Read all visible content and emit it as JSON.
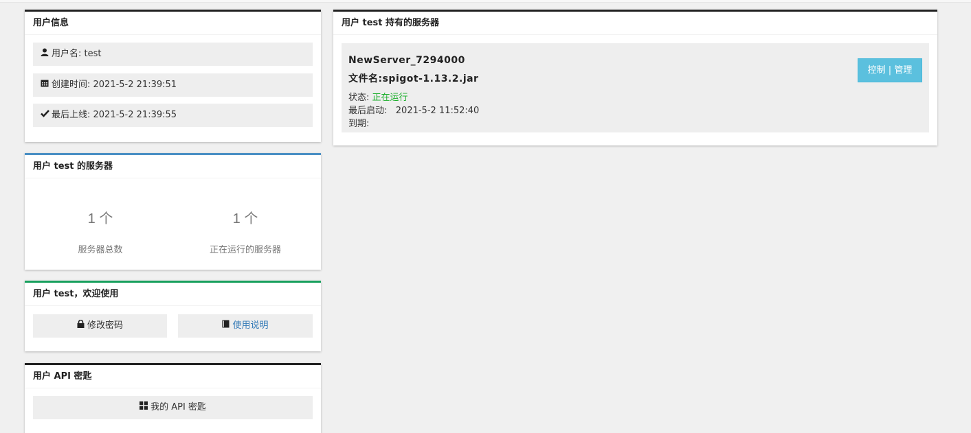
{
  "user_info": {
    "title": "用户信息",
    "username_label": "用户名: test",
    "created_label": "创建时间: 2021-5-2 21:39:51",
    "last_login_label": "最后上线: 2021-5-2 21:39:55"
  },
  "user_servers": {
    "title": "用户 test 的服务器",
    "total_count": "1 个",
    "total_label": "服务器总数",
    "running_count": "1 个",
    "running_label": "正在运行的服务器"
  },
  "welcome": {
    "title": "用户 test，欢迎使用",
    "change_password": "修改密码",
    "manual": "使用说明"
  },
  "api": {
    "title": "用户 API 密匙",
    "my_api_key": "我的 API 密匙"
  },
  "owned_servers": {
    "title": "用户 test 持有的服务器",
    "server": {
      "name": "NewServer_7294000",
      "file": "文件名:spigot-1.13.2.jar",
      "status_label": "状态: ",
      "status_value": "正在运行",
      "last_start": "最后启动:   2021-5-2 11:52:40",
      "expire": "到期:",
      "control_button": "控制 | 管理"
    }
  },
  "colors": {
    "accent_blue": "#4a8fc4",
    "accent_green": "#18a05e",
    "running_green": "#1aaf2a",
    "info_button": "#5bc0de"
  }
}
